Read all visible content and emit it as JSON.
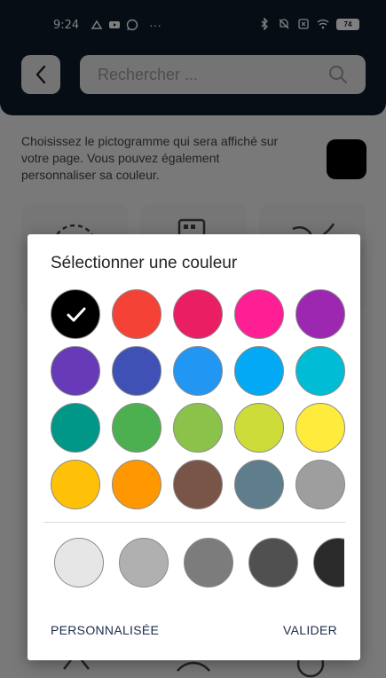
{
  "status_bar": {
    "time": "9:24",
    "battery": "74"
  },
  "search": {
    "placeholder": "Rechercher ..."
  },
  "description": "Choisissez le pictogramme qui sera affiché sur votre page. Vous pouvez également personnaliser sa couleur.",
  "selected_color": "#000000",
  "dialog": {
    "title": "Sélectionner une couleur",
    "custom_label": "PERSONNALISÉE",
    "ok_label": "VALIDER"
  },
  "palette": [
    [
      "#000000",
      "#f44336",
      "#e91e63",
      "#ff1f94",
      "#9c27b0"
    ],
    [
      "#673ab7",
      "#3f51b5",
      "#2196f3",
      "#03a9f4",
      "#00bcd4"
    ],
    [
      "#009688",
      "#4caf50",
      "#8bc34a",
      "#cddc39",
      "#ffeb3b"
    ],
    [
      "#ffc107",
      "#ff9800",
      "#795548",
      "#607d8b",
      "#9e9e9e"
    ]
  ],
  "shades": [
    "#e6e6e6",
    "#b0b0b0",
    "#7c7c7c",
    "#505050",
    "#2a2a2a"
  ]
}
